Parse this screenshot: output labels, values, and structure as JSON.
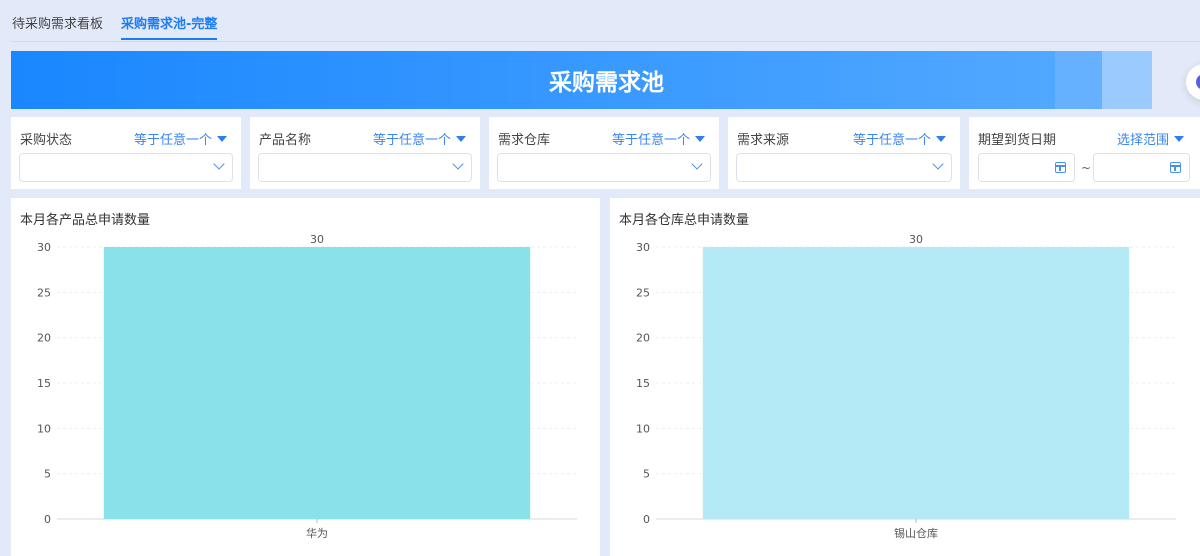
{
  "tabs": [
    {
      "label": "待采购需求看板",
      "active": false
    },
    {
      "label": "采购需求池-完整",
      "active": true
    }
  ],
  "banner": {
    "title": "采购需求池"
  },
  "filters": [
    {
      "label": "采购状态",
      "operator": "等于任意一个",
      "value": ""
    },
    {
      "label": "产品名称",
      "operator": "等于任意一个",
      "value": ""
    },
    {
      "label": "需求仓库",
      "operator": "等于任意一个",
      "value": ""
    },
    {
      "label": "需求来源",
      "operator": "等于任意一个",
      "value": ""
    },
    {
      "label": "期望到货日期",
      "operator": "选择范围",
      "range_separator": "~",
      "start": "",
      "end": ""
    }
  ],
  "chart_data": [
    {
      "type": "bar",
      "title": "本月各产品总申请数量",
      "categories": [
        "华为"
      ],
      "values": [
        30
      ],
      "ylim": [
        0,
        30
      ],
      "yticks": [
        0,
        5,
        10,
        15,
        20,
        25,
        30
      ],
      "xlabel": "",
      "ylabel": "",
      "grid": true,
      "color": "#8ae1ea"
    },
    {
      "type": "bar",
      "title": "本月各仓库总申请数量",
      "categories": [
        "锡山仓库"
      ],
      "values": [
        30
      ],
      "ylim": [
        0,
        30
      ],
      "yticks": [
        0,
        5,
        10,
        15,
        20,
        25,
        30
      ],
      "xlabel": "",
      "ylabel": "",
      "grid": true,
      "color": "#b4e9f6"
    }
  ]
}
